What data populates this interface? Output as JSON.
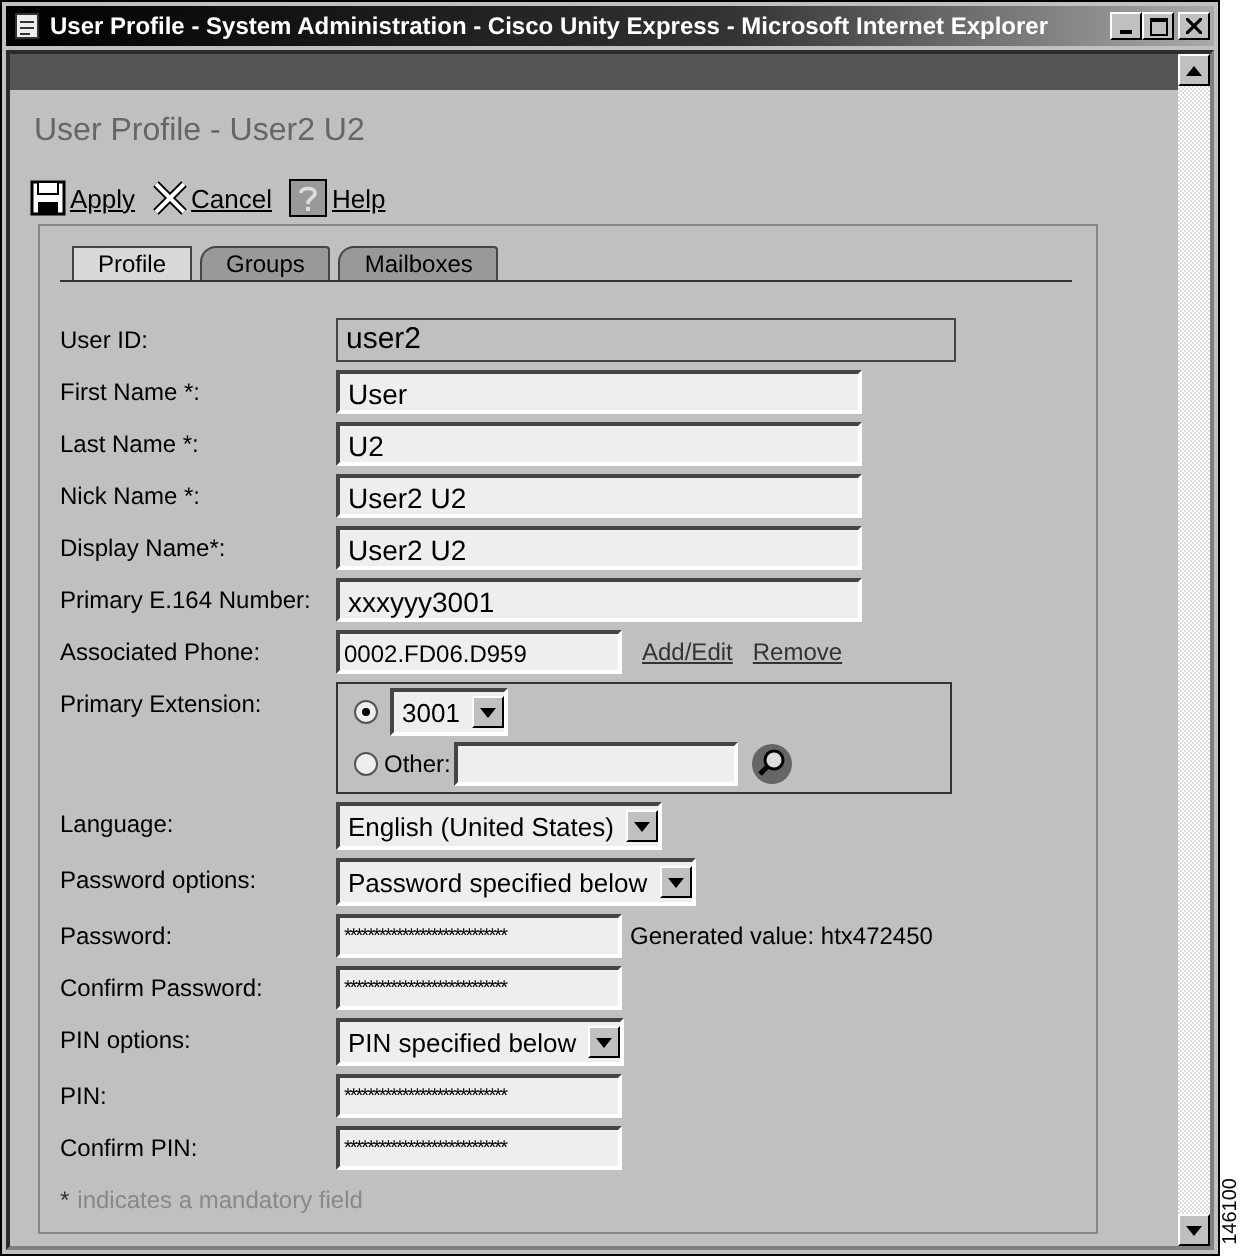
{
  "window": {
    "title": "User Profile - System Administration - Cisco Unity Express - Microsoft Internet Explorer"
  },
  "page": {
    "heading": "User Profile - User2 U2"
  },
  "toolbar": [
    {
      "kind": "save",
      "label": "Apply"
    },
    {
      "kind": "cancel",
      "label": "Cancel"
    },
    {
      "kind": "help",
      "label": "Help"
    }
  ],
  "tabs": [
    {
      "label": "Profile",
      "selected": true
    },
    {
      "label": "Groups",
      "selected": false
    },
    {
      "label": "Mailboxes",
      "selected": false
    }
  ],
  "fields": [
    {
      "kind": "readonly",
      "label": "User ID:",
      "value": "user2"
    },
    {
      "kind": "text",
      "label": "First Name *:",
      "value": "User"
    },
    {
      "kind": "text",
      "label": "Last Name *:",
      "value": "U2"
    },
    {
      "kind": "text",
      "label": "Nick Name *:",
      "value": "User2 U2"
    },
    {
      "kind": "text",
      "label": "Display Name*:",
      "value": "User2 U2"
    },
    {
      "kind": "text",
      "label": "Primary E.164 Number:",
      "value": "xxxyyy3001"
    },
    {
      "kind": "phone",
      "label": "Associated Phone:",
      "value": "0002.FD06.D959",
      "links": [
        "Add/Edit",
        "Remove"
      ]
    },
    {
      "kind": "extension",
      "label": "Primary Extension:",
      "options": [
        {
          "kind": "select",
          "selected": true,
          "value": "3001"
        },
        {
          "kind": "input",
          "selected": false,
          "label": "Other:"
        }
      ]
    },
    {
      "kind": "select",
      "label": "Language:",
      "value": "English (United States)"
    },
    {
      "kind": "select",
      "label": "Password options:",
      "value": "Password specified below"
    },
    {
      "kind": "password",
      "label": "Password:",
      "value": "****************************",
      "note": "Generated value: htx472450"
    },
    {
      "kind": "password",
      "label": "Confirm Password:",
      "value": "****************************"
    },
    {
      "kind": "select",
      "label": "PIN options:",
      "value": "PIN specified below"
    },
    {
      "kind": "password",
      "label": "PIN:",
      "value": "****************************"
    },
    {
      "kind": "password",
      "label": "Confirm PIN:",
      "value": "****************************"
    }
  ],
  "footnote": {
    "mark": "*",
    "text": "indicates a mandatory field"
  },
  "figure_id": "146100"
}
